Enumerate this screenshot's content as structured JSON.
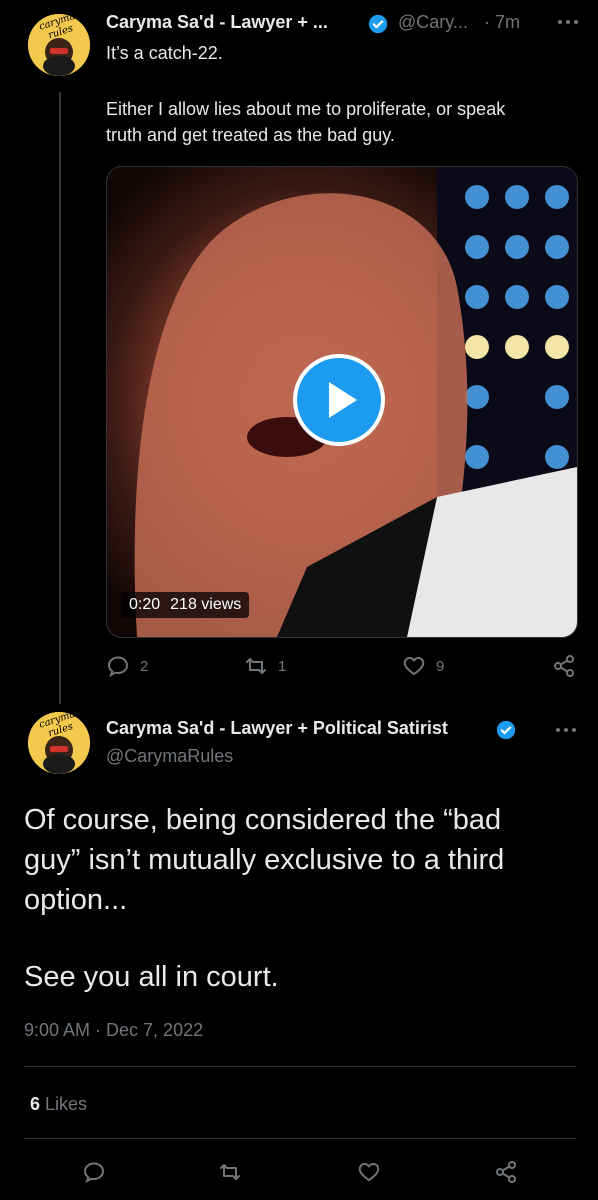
{
  "tweet1": {
    "display_name": "Caryma Sa'd - Lawyer + ...",
    "handle": "@Cary...",
    "time": "· 7m",
    "text_line1": "It’s a catch-22.",
    "text_line2": "Either I allow lies about me to proliferate, or speak",
    "text_line3": "truth and get treated as the bad guy.",
    "video_duration": "0:20",
    "video_views": "218 views",
    "replies": "2",
    "retweets": "1",
    "likes": "9",
    "more_label": "..."
  },
  "tweet2": {
    "display_name": "Caryma Sa'd - Lawyer + Political Satirist",
    "handle": "@CarymaRules",
    "more_label": "...",
    "text_line1": "Of course, being considered the “bad",
    "text_line2": "guy” isn’t mutually exclusive to a third",
    "text_line3": "option...",
    "text_line4": "See you all in court.",
    "timestamp": "9:00 AM · Dec 7, 2022",
    "likes_count": "6",
    "likes_label": "Likes"
  },
  "avatar_text": "caryma rules",
  "colors": {
    "background": "#000000",
    "text": "#e7e9ea",
    "secondary": "#71767b",
    "verified": "#1d9bf0",
    "divider": "#2f3336"
  },
  "icons": [
    "verified-badge-icon",
    "more-icon",
    "play-icon",
    "reply-icon",
    "retweet-icon",
    "like-icon",
    "share-icon"
  ]
}
